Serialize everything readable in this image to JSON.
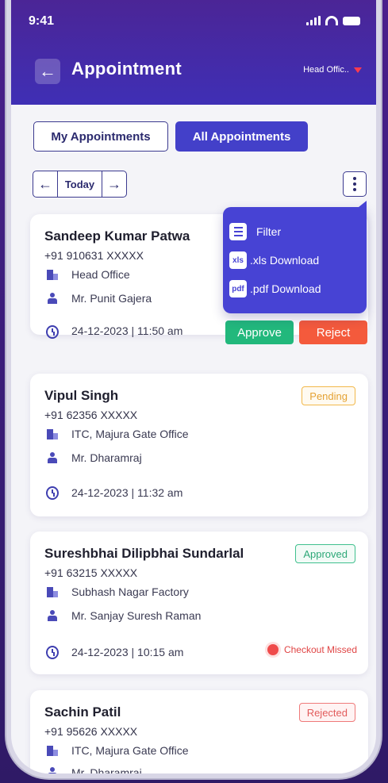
{
  "status": {
    "time": "9:41"
  },
  "header": {
    "title": "Appointment",
    "office": "Head Offic.."
  },
  "tabs": [
    {
      "label": "My Appointments"
    },
    {
      "label": "All Appointments"
    }
  ],
  "datenav": {
    "today": "Today"
  },
  "menu": {
    "items": [
      {
        "label": "Filter"
      },
      {
        "label": ".xls Download",
        "icon": "xls"
      },
      {
        "label": ".pdf Download",
        "icon": "pdf"
      }
    ]
  },
  "cards": [
    {
      "name": "Sandeep Kumar Patwa",
      "phone": "+91 910631 XXXXX",
      "office": "Head Office",
      "host": "Mr. Punit Gajera",
      "datetime": "24-12-2023 | 11:50 am",
      "approve": "Approve",
      "reject": "Reject"
    },
    {
      "name": "Vipul Singh",
      "phone": "+91 62356 XXXXX",
      "office": "ITC, Majura Gate Office",
      "host": "Mr. Dharamraj",
      "datetime": "24-12-2023 | 11:32 am",
      "status": "Pending"
    },
    {
      "name": "Sureshbhai Dilipbhai Sundarlal",
      "phone": "+91 63215 XXXXX",
      "office": "Subhash Nagar Factory",
      "host": "Mr. Sanjay Suresh Raman",
      "datetime": "24-12-2023 | 10:15 am",
      "status": "Approved",
      "note": "Checkout Missed"
    },
    {
      "name": "Sachin Patil",
      "phone": "+91 95626 XXXXX",
      "office": "ITC, Majura Gate Office",
      "host": "Mr. Dharamraj",
      "status": "Rejected"
    }
  ],
  "colors": {
    "primary": "#4340c9",
    "approve": "#22b87c",
    "reject": "#f45a3c",
    "pending": "#f2b84b",
    "approved": "#40c08e",
    "rejected": "#ef7a7a"
  }
}
